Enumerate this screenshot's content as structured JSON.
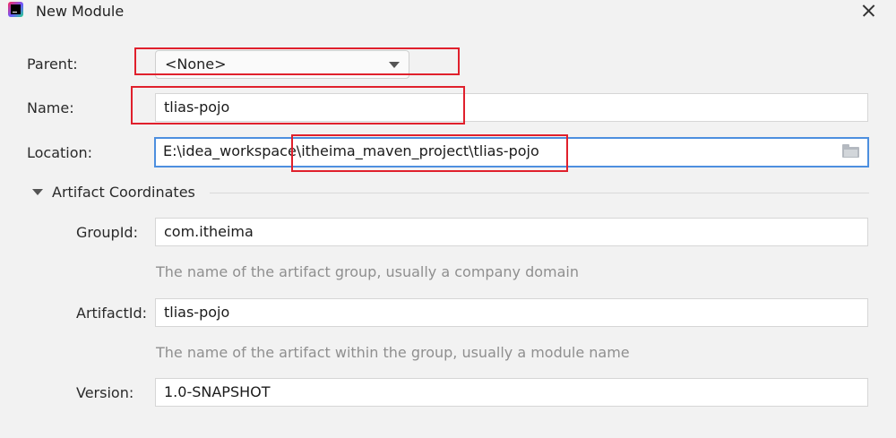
{
  "window": {
    "title": "New Module"
  },
  "form": {
    "parent": {
      "label": "Parent:",
      "value": "<None>"
    },
    "name": {
      "label": "Name:",
      "value": "tlias-pojo"
    },
    "location": {
      "label": "Location:",
      "value": "E:\\idea_workspace\\itheima_maven_project\\tlias-pojo"
    }
  },
  "artifact": {
    "section_title": "Artifact Coordinates",
    "group_id": {
      "label": "GroupId:",
      "value": "com.itheima",
      "hint": "The name of the artifact group, usually a company domain"
    },
    "artifact_id": {
      "label": "ArtifactId:",
      "value": "tlias-pojo",
      "hint": "The name of the artifact within the group, usually a module name"
    },
    "version": {
      "label": "Version:",
      "value": "1.0-SNAPSHOT"
    }
  },
  "colors": {
    "highlight": "#e0202c",
    "focus": "#4d8fdf",
    "background": "#f2f2f2"
  },
  "icons": [
    "app-logo-icon",
    "close-icon",
    "chevron-down-icon",
    "folder-icon",
    "collapse-triangle-icon"
  ]
}
